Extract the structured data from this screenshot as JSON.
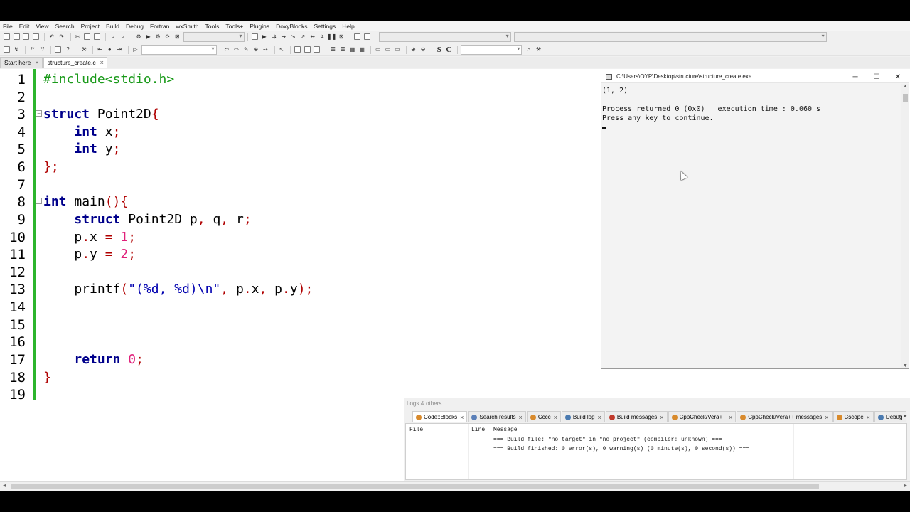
{
  "menu": [
    "File",
    "Edit",
    "View",
    "Search",
    "Project",
    "Build",
    "Debug",
    "Fortran",
    "wxSmith",
    "Tools",
    "Tools+",
    "Plugins",
    "DoxyBlocks",
    "Settings",
    "Help"
  ],
  "tabs": [
    {
      "label": "Start here",
      "active": false
    },
    {
      "label": "structure_create.c",
      "active": true
    }
  ],
  "editor": {
    "line_numbers": [
      "1",
      "2",
      "3",
      "4",
      "5",
      "6",
      "7",
      "8",
      "9",
      "10",
      "11",
      "12",
      "13",
      "14",
      "15",
      "16",
      "17",
      "18",
      "19"
    ]
  },
  "console": {
    "title": "C:\\Users\\OYP\\Desktop\\structure\\structure_create.exe",
    "lines": [
      "(1, 2)",
      "",
      "Process returned 0 (0x0)   execution time : 0.060 s",
      "Press any key to continue."
    ]
  },
  "logs": {
    "caption": "Logs & others",
    "tabs": [
      {
        "label": "Code::Blocks",
        "color": "#d88a2c",
        "active": true
      },
      {
        "label": "Search results",
        "color": "#5a7fb8",
        "active": false
      },
      {
        "label": "Cccc",
        "color": "#d88a2c",
        "active": false
      },
      {
        "label": "Build log",
        "color": "#4a7ab0",
        "active": false
      },
      {
        "label": "Build messages",
        "color": "#c0392b",
        "active": false
      },
      {
        "label": "CppCheck/Vera++",
        "color": "#d88a2c",
        "active": false
      },
      {
        "label": "CppCheck/Vera++ messages",
        "color": "#d88a2c",
        "active": false
      },
      {
        "label": "Cscope",
        "color": "#d88a2c",
        "active": false
      },
      {
        "label": "Debug",
        "color": "#4a7ab0",
        "active": false
      }
    ],
    "columns": {
      "file": "File",
      "line": "Line",
      "message": "Message"
    },
    "messages": [
      "=== Build file: \"no target\" in \"no project\" (compiler: unknown) ===",
      "=== Build finished: 0 error(s), 0 warning(s) (0 minute(s), 0 second(s)) ==="
    ]
  }
}
